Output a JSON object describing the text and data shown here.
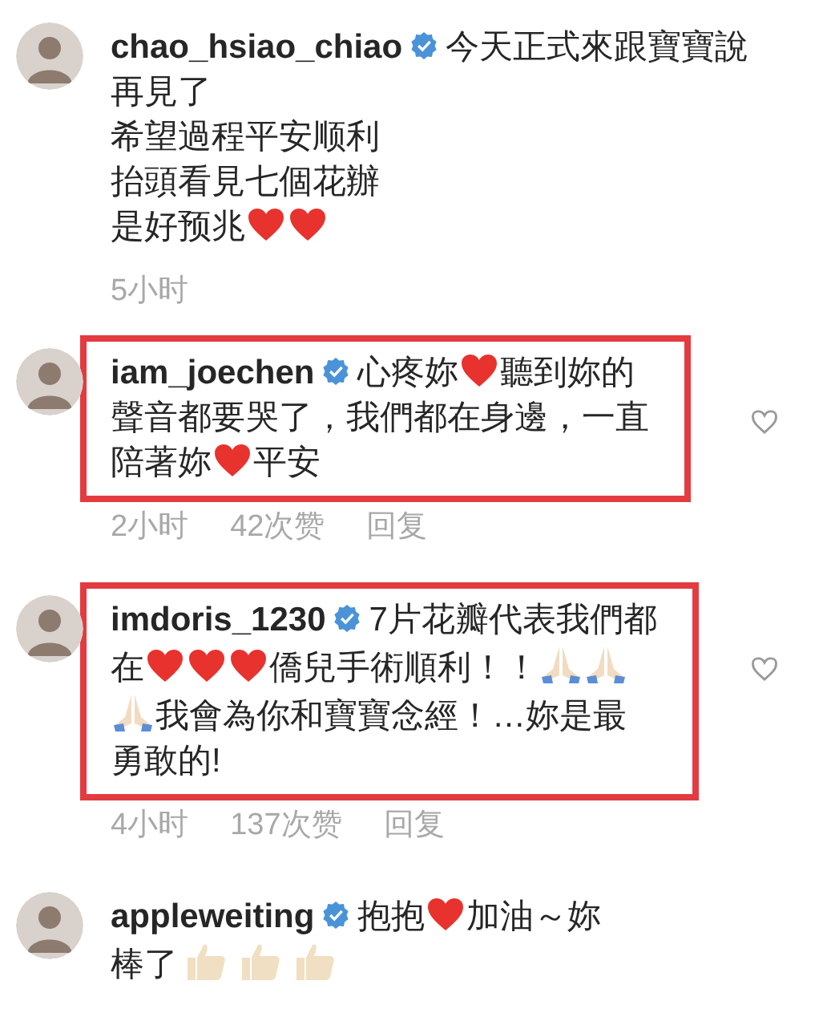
{
  "comments": [
    {
      "username": "chao_hsiao_chiao",
      "verified": true,
      "highlighted": false,
      "like_icon": false,
      "lines": [
        [
          {
            "kind": "text",
            "text": "今天正式來跟寶寶說"
          }
        ],
        [
          {
            "kind": "text",
            "text": "再見了"
          }
        ],
        [
          {
            "kind": "text",
            "text": "希望過程平安顺利"
          }
        ],
        [
          {
            "kind": "text",
            "text": "抬頭看見七個花辦"
          }
        ],
        [
          {
            "kind": "text",
            "text": "是好预兆"
          },
          {
            "kind": "heart"
          },
          {
            "kind": "heart"
          }
        ]
      ],
      "time": "5小时"
    },
    {
      "username": "iam_joechen",
      "verified": true,
      "highlighted": true,
      "like_icon": true,
      "lines": [
        [
          {
            "kind": "text",
            "text": "心疼妳"
          },
          {
            "kind": "heart"
          },
          {
            "kind": "text",
            "text": "聽到妳的"
          }
        ],
        [
          {
            "kind": "text",
            "text": "聲音都要哭了，我們都在身邊，一直"
          }
        ],
        [
          {
            "kind": "text",
            "text": "陪著妳"
          },
          {
            "kind": "heart"
          },
          {
            "kind": "text",
            "text": "平安"
          }
        ]
      ],
      "time": "2小时",
      "likes": "42次赞",
      "reply": "回复"
    },
    {
      "username": "imdoris_1230",
      "verified": true,
      "highlighted": true,
      "like_icon": true,
      "lines": [
        [
          {
            "kind": "text",
            "text": "7片花瓣代表我們都"
          }
        ],
        [
          {
            "kind": "text",
            "text": "在"
          },
          {
            "kind": "heart"
          },
          {
            "kind": "heart"
          },
          {
            "kind": "heart"
          },
          {
            "kind": "text",
            "text": "僑兒手術順利！！"
          },
          {
            "kind": "pray"
          },
          {
            "kind": "pray"
          }
        ],
        [
          {
            "kind": "pray"
          },
          {
            "kind": "text",
            "text": "我會為你和寶寶念經！…妳是最"
          }
        ],
        [
          {
            "kind": "text",
            "text": "勇敢的!"
          }
        ]
      ],
      "time": "4小时",
      "likes": "137次赞",
      "reply": "回复"
    },
    {
      "username": "appleweiting",
      "verified": true,
      "highlighted": false,
      "like_icon": false,
      "lines": [
        [
          {
            "kind": "text",
            "text": "抱抱"
          },
          {
            "kind": "heart"
          },
          {
            "kind": "text",
            "text": "加油～妳"
          }
        ],
        [
          {
            "kind": "text",
            "text": "棒了"
          },
          {
            "kind": "thumbs"
          },
          {
            "kind": "thumbs"
          },
          {
            "kind": "thumbs"
          }
        ]
      ]
    }
  ]
}
